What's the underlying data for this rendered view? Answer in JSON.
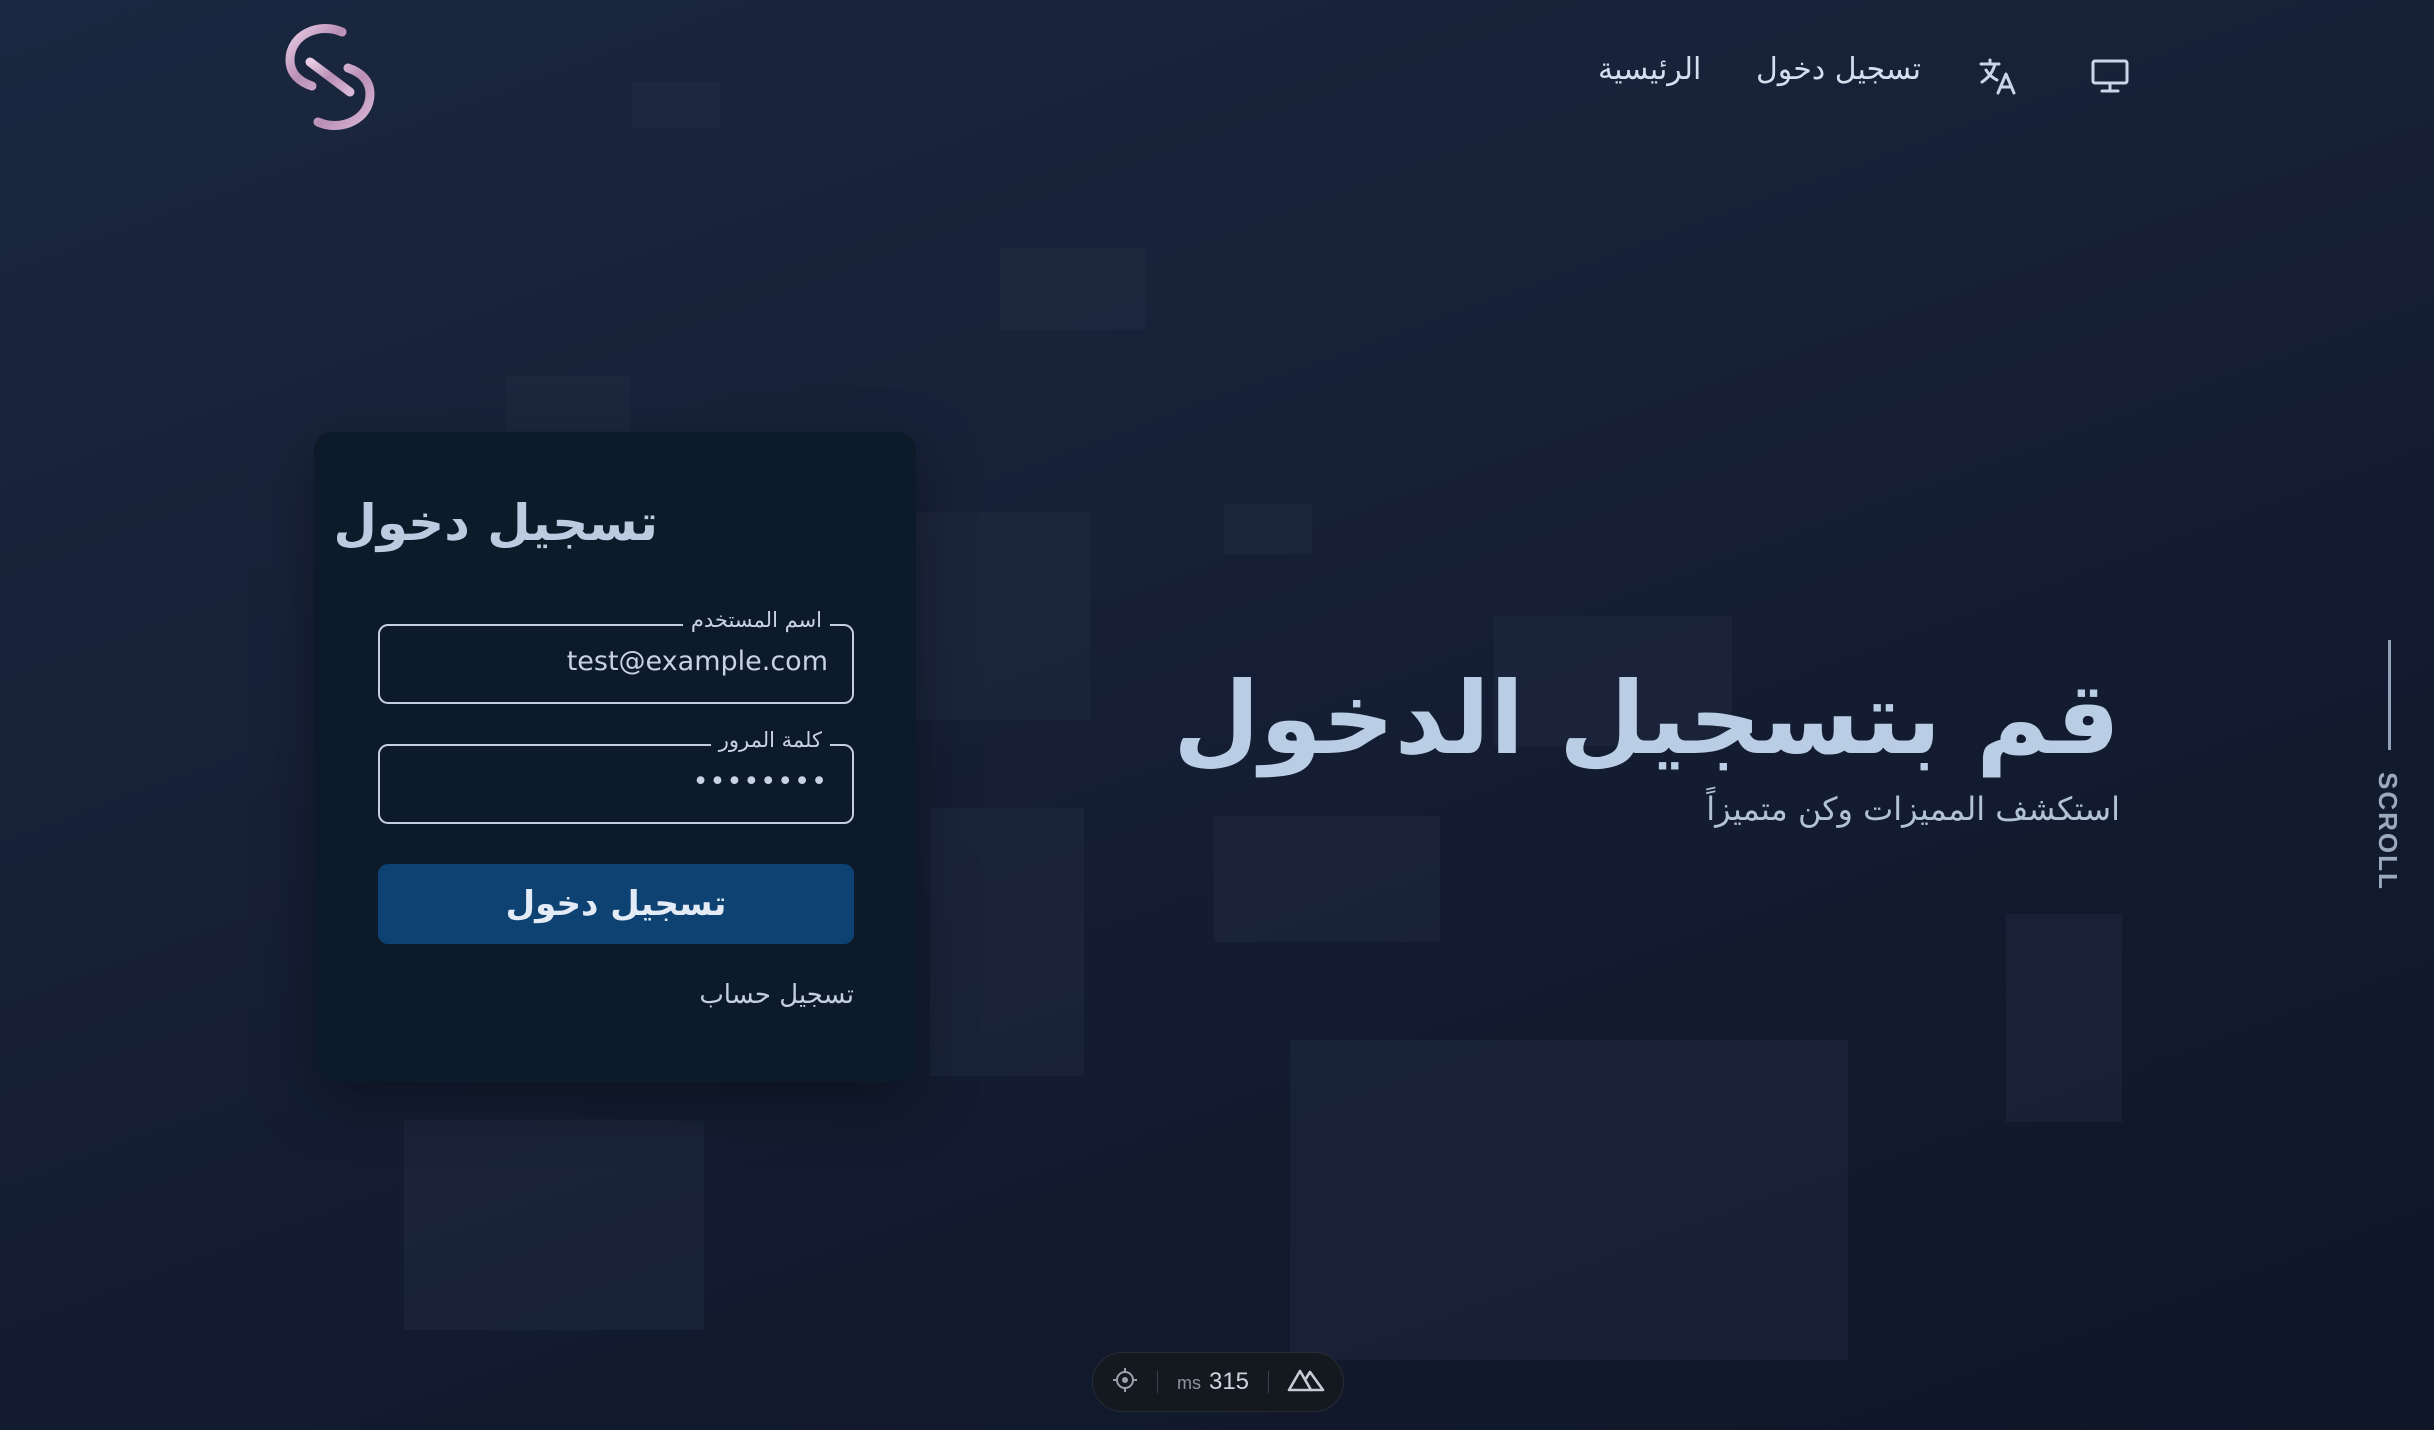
{
  "header": {
    "nav": {
      "home": "الرئيسية",
      "login": "تسجيل دخول"
    },
    "icons": [
      "link-logo",
      "translate-icon",
      "monitor-icon"
    ]
  },
  "login_card": {
    "title": "تسجيل دخول",
    "username": {
      "label": "اسم المستخدم",
      "value": "test@example.com"
    },
    "password": {
      "label": "كلمة المرور",
      "value": "••••••••"
    },
    "submit_label": "تسجيل دخول",
    "register_link": "تسجيل حساب"
  },
  "hero": {
    "title": "قم بتسجيل الدخول",
    "subtitle": "استكشف المميزات وكن متميزاً"
  },
  "scroll_label": "SCROLL",
  "devtools": {
    "value": "315",
    "unit": "ms"
  },
  "colors": {
    "background": "#172138",
    "card": "#0c1a2a",
    "button": "#0e4273",
    "text": "#c9d6e8"
  }
}
